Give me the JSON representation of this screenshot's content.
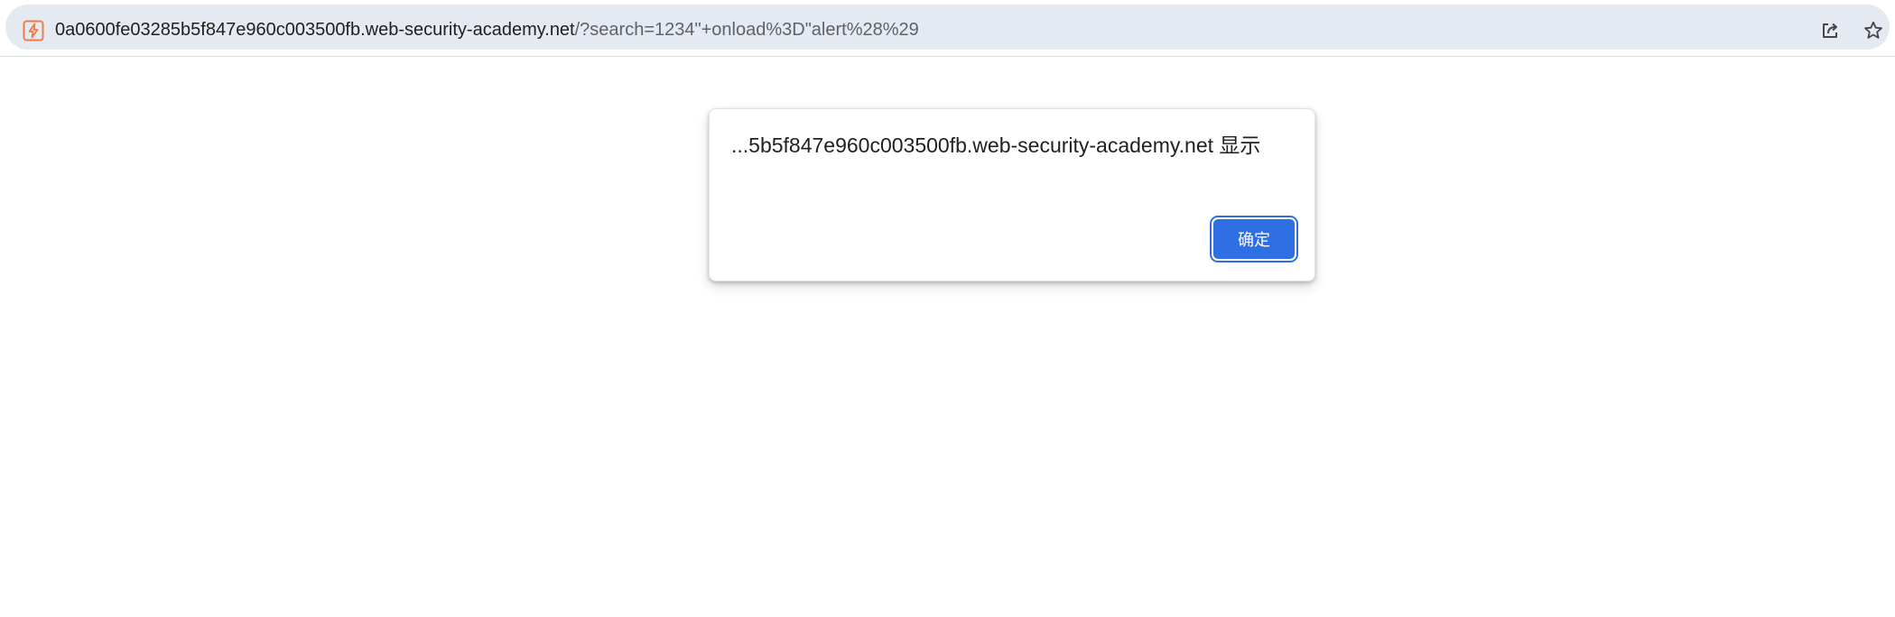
{
  "address_bar": {
    "url_host": "0a0600fe03285b5f847e960c003500fb.web-security-academy.net",
    "url_path": "/?search=1234\"+onload%3D\"alert%28%29",
    "site_icon": "lightning-bolt-icon",
    "actions": [
      {
        "name": "share-icon"
      },
      {
        "name": "star-icon"
      }
    ]
  },
  "alert_dialog": {
    "title": "...5b5f847e960c003500fb.web-security-academy.net 显示",
    "ok_label": "确定"
  },
  "colors": {
    "omnibox_bg": "#e5e9f1",
    "accent": "#2f6fe4",
    "site_icon": "#f07b45"
  }
}
